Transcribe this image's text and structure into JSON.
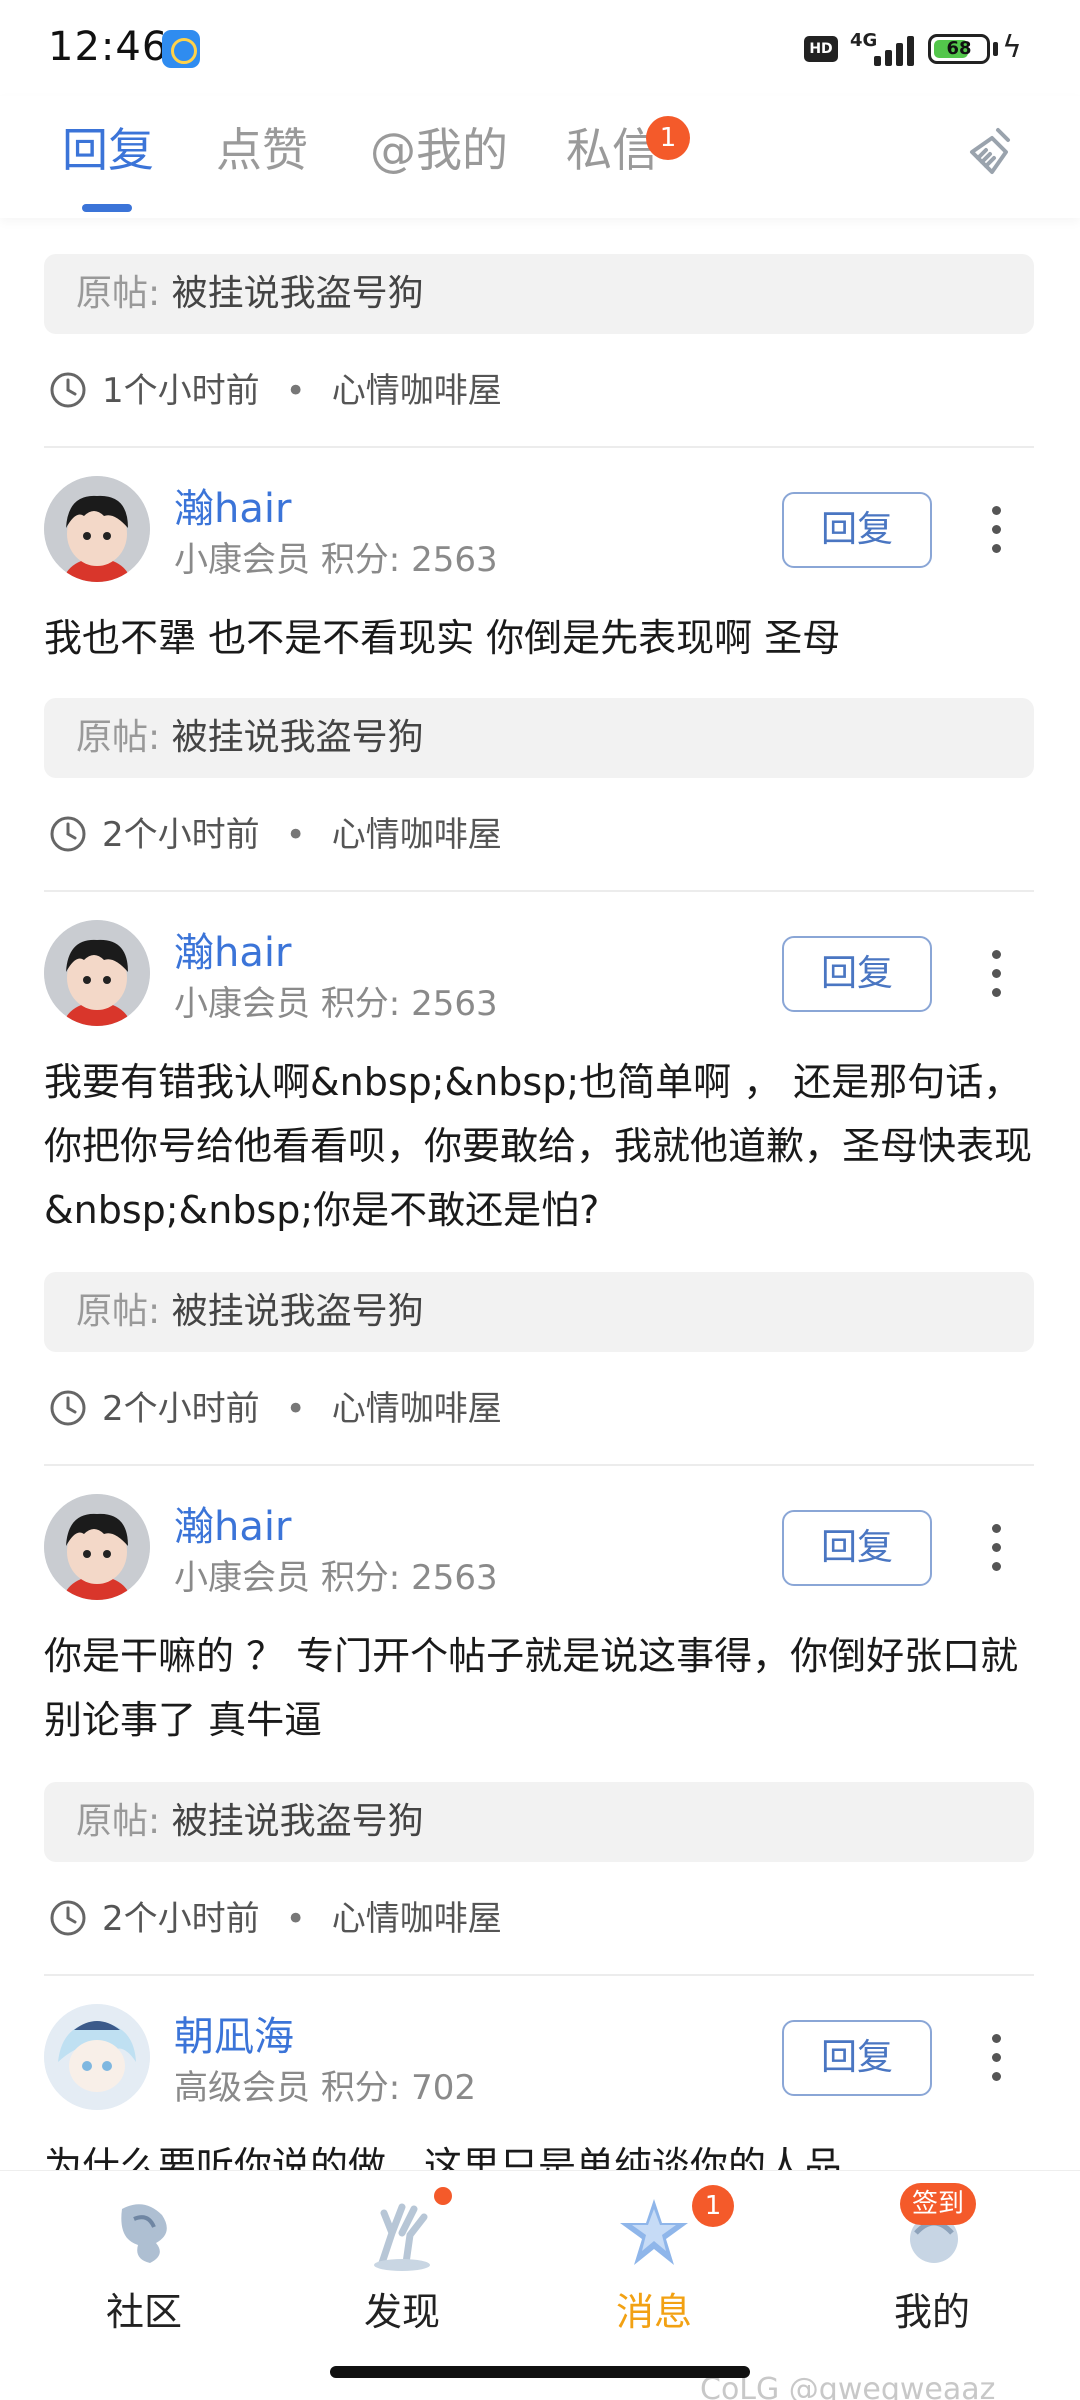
{
  "status_bar": {
    "time": "12:46",
    "hd": "HD",
    "network": "4G",
    "battery": "68",
    "battery_level": 0.68
  },
  "tabs": [
    {
      "label": "回复",
      "active": true
    },
    {
      "label": "点赞",
      "active": false
    },
    {
      "label": "@我的",
      "active": false
    },
    {
      "label": "私信",
      "active": false,
      "badge": "1"
    }
  ],
  "top_item": {
    "original_label": "原帖:",
    "original_title": "被挂说我盗号狗",
    "time": "1个小时前",
    "board": "心情咖啡屋"
  },
  "replies": [
    {
      "username": "瀚hair",
      "level": "小康会员",
      "points_label": "积分:",
      "points": "2563",
      "reply_label": "回复",
      "text": "我也不犟 也不是不看现实 你倒是先表现啊 圣母",
      "original_label": "原帖:",
      "original_title": "被挂说我盗号狗",
      "time": "2个小时前",
      "board": "心情咖啡屋"
    },
    {
      "username": "瀚hair",
      "level": "小康会员",
      "points_label": "积分:",
      "points": "2563",
      "reply_label": "回复",
      "text": "我要有错我认啊&nbsp;&nbsp;也简单啊 ， 还是那句话，你把你号给他看看呗，你要敢给，我就他道歉，圣母快表现&nbsp;&nbsp;你是不敢还是怕?",
      "original_label": "原帖:",
      "original_title": "被挂说我盗号狗",
      "time": "2个小时前",
      "board": "心情咖啡屋"
    },
    {
      "username": "瀚hair",
      "level": "小康会员",
      "points_label": "积分:",
      "points": "2563",
      "reply_label": "回复",
      "text": "你是干嘛的 ？ 专门开个帖子就是说这事得，你倒好张口就别论事了 真牛逼",
      "original_label": "原帖:",
      "original_title": "被挂说我盗号狗",
      "time": "2个小时前",
      "board": "心情咖啡屋"
    },
    {
      "username": "朝凪海",
      "level": "高级会员",
      "points_label": "积分:",
      "points": "702",
      "reply_label": "回复",
      "text": "为什么要听你说的做，这里只是单纯谈你的人品"
    }
  ],
  "bottom_nav": [
    {
      "label": "社区",
      "active": false,
      "icon": "community-icon"
    },
    {
      "label": "发现",
      "active": false,
      "icon": "discover-icon",
      "dot": true
    },
    {
      "label": "消息",
      "active": true,
      "icon": "message-icon",
      "badge": "1"
    },
    {
      "label": "我的",
      "active": false,
      "icon": "profile-icon",
      "pill": "签到"
    }
  ],
  "watermark": "CoLG @qweqweaaz",
  "colors": {
    "accent": "#3b74d8",
    "active_nav": "#f2a113",
    "badge": "#f45a2a"
  }
}
